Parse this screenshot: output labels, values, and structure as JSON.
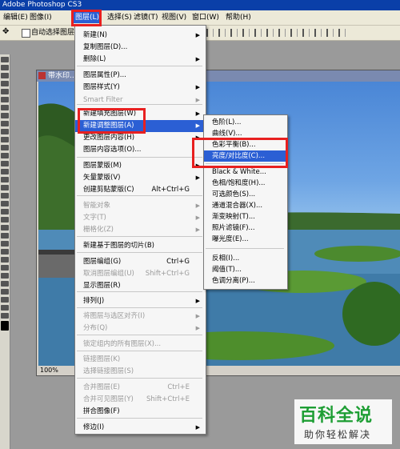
{
  "app": {
    "title": "Adobe Photoshop CS3"
  },
  "menubar": {
    "items": [
      "编辑(E)",
      "图像(I)",
      "图层(L)",
      "选择(S)",
      "滤镜(T)",
      "视图(V)",
      "窗口(W)",
      "帮助(H)"
    ]
  },
  "options": {
    "auto_select": "自动选择图层"
  },
  "document": {
    "title": "带水印...",
    "zoom": "100%"
  },
  "layer_menu": {
    "items": [
      {
        "label": "新建(N)",
        "shortcut": "",
        "submenu": true,
        "disabled": false
      },
      {
        "label": "复制图层(D)...",
        "shortcut": "",
        "submenu": false,
        "disabled": false
      },
      {
        "label": "删除(L)",
        "shortcut": "",
        "submenu": true,
        "disabled": false
      },
      {
        "label": "图层属性(P)...",
        "shortcut": "",
        "submenu": false,
        "disabled": false
      },
      {
        "label": "图层样式(Y)",
        "shortcut": "",
        "submenu": true,
        "disabled": false
      },
      {
        "label": "Smart Filter",
        "shortcut": "",
        "submenu": true,
        "disabled": true
      },
      {
        "label": "新建填充图层(W)",
        "shortcut": "",
        "submenu": true,
        "disabled": false
      },
      {
        "label": "新建调整图层(A)",
        "shortcut": "",
        "submenu": true,
        "disabled": false,
        "highlighted": true
      },
      {
        "label": "更改图层内容(H)",
        "shortcut": "",
        "submenu": true,
        "disabled": false
      },
      {
        "label": "图层内容选项(O)...",
        "shortcut": "",
        "submenu": false,
        "disabled": false
      },
      {
        "label": "图层蒙版(M)",
        "shortcut": "",
        "submenu": true,
        "disabled": false
      },
      {
        "label": "矢量蒙版(V)",
        "shortcut": "",
        "submenu": true,
        "disabled": false
      },
      {
        "label": "创建剪贴蒙版(C)",
        "shortcut": "Alt+Ctrl+G",
        "submenu": false,
        "disabled": false
      },
      {
        "label": "智能对象",
        "shortcut": "",
        "submenu": true,
        "disabled": true
      },
      {
        "label": "文字(T)",
        "shortcut": "",
        "submenu": true,
        "disabled": true
      },
      {
        "label": "栅格化(Z)",
        "shortcut": "",
        "submenu": true,
        "disabled": true
      },
      {
        "label": "新建基于图层的切片(B)",
        "shortcut": "",
        "submenu": false,
        "disabled": false
      },
      {
        "label": "图层编组(G)",
        "shortcut": "Ctrl+G",
        "submenu": false,
        "disabled": false
      },
      {
        "label": "取消图层编组(U)",
        "shortcut": "Shift+Ctrl+G",
        "submenu": false,
        "disabled": true
      },
      {
        "label": "显示图层(R)",
        "shortcut": "",
        "submenu": false,
        "disabled": false
      },
      {
        "label": "排列(J)",
        "shortcut": "",
        "submenu": true,
        "disabled": false
      },
      {
        "label": "将图层与选区对齐(I)",
        "shortcut": "",
        "submenu": true,
        "disabled": true
      },
      {
        "label": "分布(Q)",
        "shortcut": "",
        "submenu": true,
        "disabled": true
      },
      {
        "label": "锁定组内的所有图层(X)...",
        "shortcut": "",
        "submenu": false,
        "disabled": true
      },
      {
        "label": "链接图层(K)",
        "shortcut": "",
        "submenu": false,
        "disabled": true
      },
      {
        "label": "选择链接图层(S)",
        "shortcut": "",
        "submenu": false,
        "disabled": true
      },
      {
        "label": "合并图层(E)",
        "shortcut": "Ctrl+E",
        "submenu": false,
        "disabled": true
      },
      {
        "label": "合并可见图层(Y)",
        "shortcut": "Shift+Ctrl+E",
        "submenu": false,
        "disabled": true
      },
      {
        "label": "拼合图像(F)",
        "shortcut": "",
        "submenu": false,
        "disabled": false
      },
      {
        "label": "修边(I)",
        "shortcut": "",
        "submenu": true,
        "disabled": false
      }
    ]
  },
  "adjust_menu": {
    "items": [
      {
        "label": "色阶(L)...",
        "highlighted": false
      },
      {
        "label": "曲线(V)...",
        "highlighted": false
      },
      {
        "label": "色彩平衡(B)...",
        "highlighted": false
      },
      {
        "label": "亮度/对比度(C)...",
        "highlighted": true
      },
      {
        "label": "Black & White...",
        "highlighted": false
      },
      {
        "label": "色相/饱和度(H)...",
        "highlighted": false
      },
      {
        "label": "可选颜色(S)...",
        "highlighted": false
      },
      {
        "label": "通道混合器(X)...",
        "highlighted": false
      },
      {
        "label": "渐变映射(T)...",
        "highlighted": false
      },
      {
        "label": "照片滤镜(F)...",
        "highlighted": false
      },
      {
        "label": "曝光度(E)...",
        "highlighted": false
      },
      {
        "label": "反相(I)...",
        "highlighted": false
      },
      {
        "label": "阈值(T)...",
        "highlighted": false
      },
      {
        "label": "色调分离(P)...",
        "highlighted": false
      }
    ]
  },
  "watermark": {
    "brand": "百科全说",
    "slogan": "助你轻松解决"
  },
  "colors": {
    "highlight": "#2b5fd4",
    "red_box": "#e82020",
    "brand_green": "#1e9e34"
  }
}
